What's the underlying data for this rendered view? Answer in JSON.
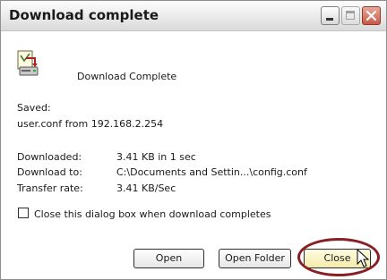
{
  "window": {
    "title": "Download complete",
    "controls": [
      "minimize-icon",
      "maximize-icon",
      "close-icon"
    ]
  },
  "dialog": {
    "heading": "Download Complete",
    "saved_label": "Saved:",
    "saved_value": "user.conf from 192.168.2.254",
    "details": [
      {
        "label": "Downloaded:",
        "value": "3.41 KB in 1 sec"
      },
      {
        "label": "Download to:",
        "value": "C:\\Documents and Settin...\\config.conf"
      },
      {
        "label": "Transfer rate:",
        "value": "3.41 KB/Sec"
      }
    ],
    "checkbox_label": "Close this dialog box when download completes",
    "checkbox_checked": false
  },
  "buttons": {
    "open": "Open",
    "open_folder": "Open Folder",
    "close": "Close"
  },
  "colors": {
    "highlight_ring": "#8a1e25",
    "close_button_hover": "#f4ebaa"
  }
}
